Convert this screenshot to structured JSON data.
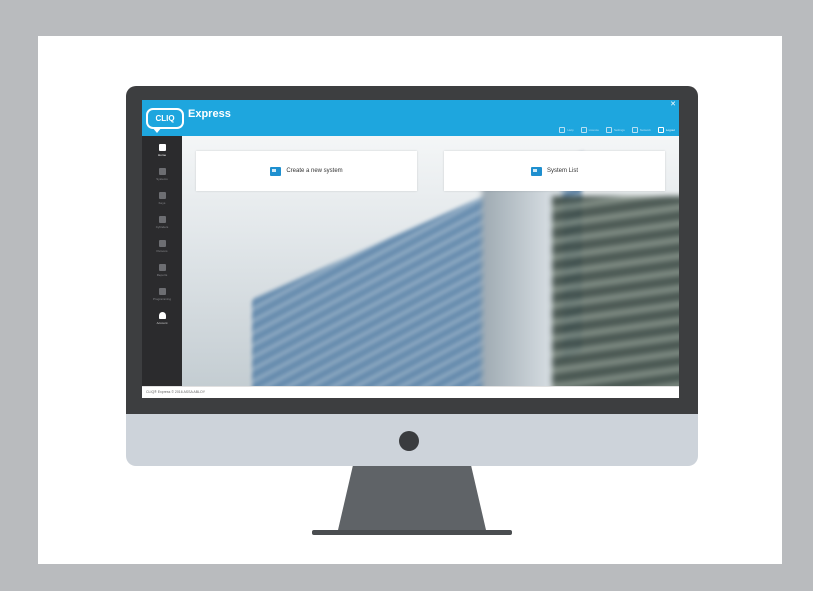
{
  "app": {
    "logo_text": "CLIQ",
    "title": "Express",
    "close_symbol": "✕"
  },
  "toolbar": {
    "links": [
      {
        "label": "Help",
        "icon": "help-icon"
      },
      {
        "label": "Licence",
        "icon": "licence-icon"
      },
      {
        "label": "Settings",
        "icon": "settings-icon"
      },
      {
        "label": "Network",
        "icon": "network-icon"
      },
      {
        "label": "Logout",
        "icon": "logout-icon"
      }
    ]
  },
  "sidebar": {
    "items": [
      {
        "label": "Home",
        "icon": "home-icon",
        "active": true
      },
      {
        "label": "Systems",
        "icon": "systems-icon",
        "active": false
      },
      {
        "label": "Keys",
        "icon": "key-icon",
        "active": false
      },
      {
        "label": "Cylinders",
        "icon": "cylinder-icon",
        "active": false
      },
      {
        "label": "Persons",
        "icon": "person-icon",
        "active": false
      },
      {
        "label": "Reports",
        "icon": "report-icon",
        "active": false
      },
      {
        "label": "Programming",
        "icon": "programming-icon",
        "active": false
      },
      {
        "label": "Account",
        "icon": "account-icon",
        "active": false
      }
    ]
  },
  "main": {
    "create_system_label": "Create a new system",
    "system_list_label": "System List"
  },
  "status": {
    "text": "CLIQ® Express © 2016 ASSA ABLOY"
  },
  "colors": {
    "header": "#1ea6de",
    "sidebar": "#2b2b2d",
    "accent_icon": "#1e8fcf",
    "background_gray": "#b9bbbe"
  }
}
